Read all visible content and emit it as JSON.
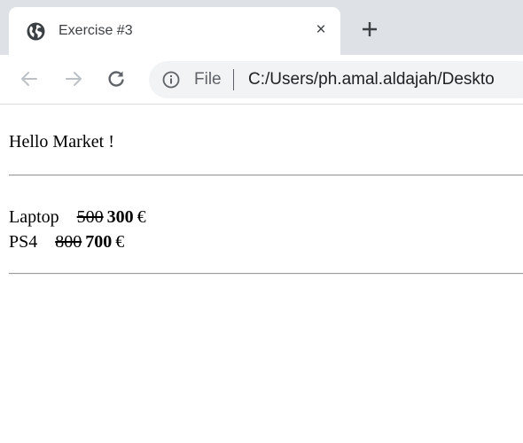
{
  "tab": {
    "title": "Exercise #3",
    "favicon": "globe-icon",
    "close_glyph": "×"
  },
  "new_tab_icon": "plus-icon",
  "toolbar": {
    "back_icon": "arrow-left-icon",
    "forward_icon": "arrow-right-icon",
    "reload_icon": "reload-icon",
    "info_icon": "info-icon",
    "scheme_label": "File",
    "url": "C:/Users/ph.amal.aldajah/Deskto"
  },
  "page": {
    "greeting": "Hello Market !",
    "products": [
      {
        "name": "Laptop",
        "old_price": "500",
        "new_price": "300",
        "currency": "€"
      },
      {
        "name": "PS4",
        "old_price": "800",
        "new_price": "700",
        "currency": "€"
      }
    ]
  },
  "colors": {
    "tab_strip": "#dee1e6",
    "omnibox": "#f1f3f4",
    "icon_gray": "#5f6368",
    "disabled_icon": "#bdc1c6"
  }
}
